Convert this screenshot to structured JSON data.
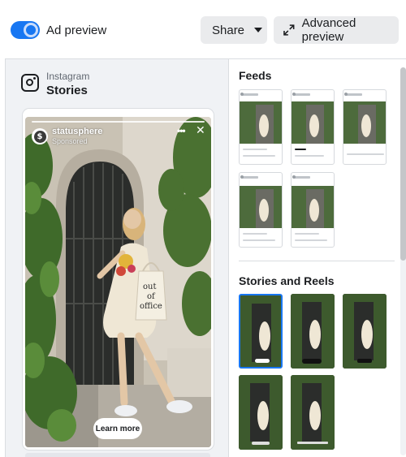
{
  "topbar": {
    "toggle_label": "Ad preview",
    "share_label": "Share",
    "advanced_label": "Advanced preview"
  },
  "preview": {
    "platform": "Instagram",
    "placement": "Stories",
    "story": {
      "account": "statusphere",
      "sponsored": "Sponsored",
      "avatar_letter": "$",
      "cta": "Learn more",
      "bag_text": [
        "out",
        "of",
        "office"
      ]
    }
  },
  "placements": {
    "feeds_title": "Feeds",
    "stories_title": "Stories and Reels",
    "feed_thumbnails": [
      "feed-1",
      "feed-2",
      "feed-3",
      "feed-4",
      "feed-5"
    ],
    "story_thumbnails": [
      "story-1",
      "story-2",
      "story-3",
      "story-4",
      "story-5"
    ],
    "selected_story": "story-1"
  },
  "colors": {
    "accent": "#1877f2",
    "button_bg": "#eaebed",
    "panel_bg": "#f0f2f5"
  }
}
